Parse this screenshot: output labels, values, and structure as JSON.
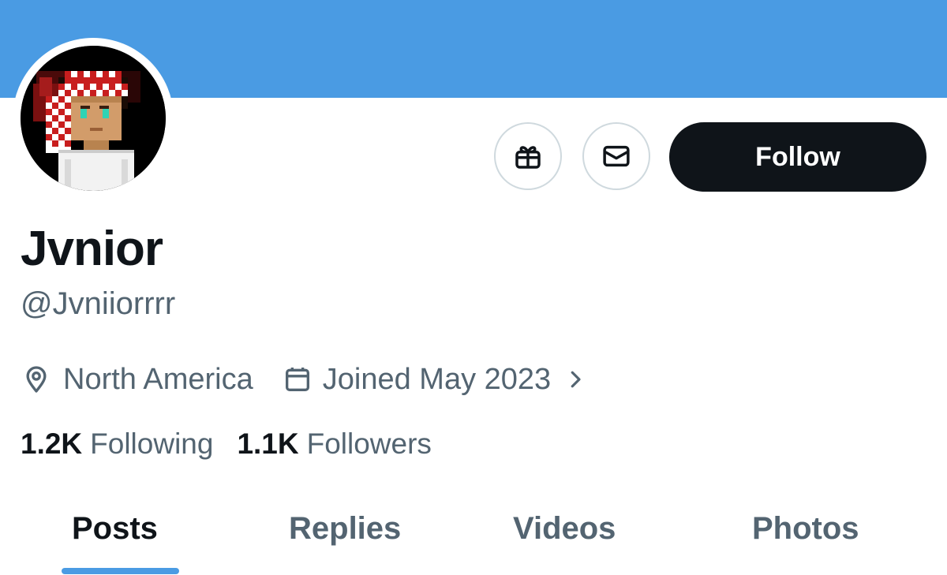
{
  "colors": {
    "banner": "#4a9be3",
    "accent": "#4a9be3",
    "primary_text": "#0f1419",
    "secondary_text": "#536471",
    "button_border": "#cfd9de"
  },
  "profile": {
    "display_name": "Jvnior",
    "handle": "@Jvniiorrrr",
    "location": "North America",
    "joined": "Joined May 2023"
  },
  "actions": {
    "gift_icon": "gift-icon",
    "message_icon": "envelope-icon",
    "follow_label": "Follow"
  },
  "stats": {
    "following_count": "1.2K",
    "following_label": "Following",
    "followers_count": "1.1K",
    "followers_label": "Followers"
  },
  "tabs": [
    {
      "label": "Posts",
      "active": true
    },
    {
      "label": "Replies",
      "active": false
    },
    {
      "label": "Videos",
      "active": false
    },
    {
      "label": "Photos",
      "active": false
    }
  ]
}
